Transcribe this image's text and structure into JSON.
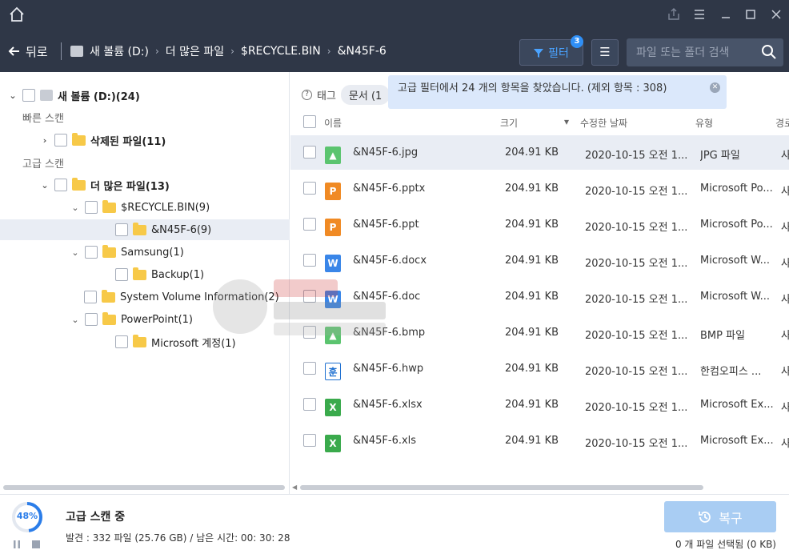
{
  "titlebar": {
    "home_icon": "home-icon",
    "controls": [
      "share-icon",
      "menu-icon",
      "minimize-icon",
      "maximize-icon",
      "close-icon"
    ]
  },
  "nav": {
    "back_label": "뒤로",
    "breadcrumbs": [
      "새 볼륨 (D:)",
      "더 많은 파일",
      "$RECYCLE.BIN",
      "&N45F-6"
    ],
    "filter_label": "필터",
    "filter_badge": "3",
    "search_placeholder": "파일 또는 폴더 검색"
  },
  "tree": {
    "root": "새 볼륨 (D:)(24)",
    "quick_scan_title": "빠른 스캔",
    "deleted_files": "삭제된 파일(11)",
    "advanced_scan_title": "고급 스캔",
    "more_files": "더 많은 파일(13)",
    "recycle_bin": "$RECYCLE.BIN(9)",
    "n45f": "&N45F-6(9)",
    "samsung": "Samsung(1)",
    "backup": "Backup(1)",
    "system_volume": "System Volume Information(2)",
    "powerpoint": "PowerPoint(1)",
    "ms_account": "Microsoft 계정(1)"
  },
  "tagbar": {
    "label": "태그",
    "chip": "문서 (1"
  },
  "tooltip": {
    "text": "고급 필터에서 24 개의 항목을 찾았습니다. (제외 항목 :  308)"
  },
  "table": {
    "headers": {
      "name": "이름",
      "size": "크기",
      "date": "수정한 날짜",
      "type": "유형",
      "path": "경로"
    },
    "rows": [
      {
        "name": "&N45F-6.jpg",
        "size": "204.91 KB",
        "date": "2020-10-15 오전 1...",
        "type": "JPG 파일",
        "path": "사",
        "icon": "image-file-icon",
        "color": "#5bc46f",
        "glyph": "▲"
      },
      {
        "name": "&N45F-6.pptx",
        "size": "204.91 KB",
        "date": "2020-10-15 오전 1...",
        "type": "Microsoft Po...",
        "path": "사",
        "icon": "powerpoint-file-icon",
        "color": "#f08a24",
        "glyph": "P"
      },
      {
        "name": "&N45F-6.ppt",
        "size": "204.91 KB",
        "date": "2020-10-15 오전 1...",
        "type": "Microsoft Po...",
        "path": "사",
        "icon": "powerpoint-file-icon",
        "color": "#f08a24",
        "glyph": "P"
      },
      {
        "name": "&N45F-6.docx",
        "size": "204.91 KB",
        "date": "2020-10-15 오전 1...",
        "type": "Microsoft W...",
        "path": "사",
        "icon": "word-file-icon",
        "color": "#3a86e8",
        "glyph": "W"
      },
      {
        "name": "&N45F-6.doc",
        "size": "204.91 KB",
        "date": "2020-10-15 오전 1...",
        "type": "Microsoft W...",
        "path": "사",
        "icon": "word-file-icon",
        "color": "#3a86e8",
        "glyph": "W"
      },
      {
        "name": "&N45F-6.bmp",
        "size": "204.91 KB",
        "date": "2020-10-15 오전 1...",
        "type": "BMP 파일",
        "path": "사",
        "icon": "image-file-icon",
        "color": "#5bc46f",
        "glyph": "▲"
      },
      {
        "name": "&N45F-6.hwp",
        "size": "204.91 KB",
        "date": "2020-10-15 오전 1...",
        "type": "한컴오피스 ...",
        "path": "사",
        "icon": "hwp-file-icon",
        "color": "#ffffff",
        "glyph": "훈"
      },
      {
        "name": "&N45F-6.xlsx",
        "size": "204.91 KB",
        "date": "2020-10-15 오전 1...",
        "type": "Microsoft Ex...",
        "path": "사",
        "icon": "excel-file-icon",
        "color": "#3aaa4c",
        "glyph": "X"
      },
      {
        "name": "&N45F-6.xls",
        "size": "204.91 KB",
        "date": "2020-10-15 오전 1...",
        "type": "Microsoft Ex...",
        "path": "사",
        "icon": "excel-file-icon",
        "color": "#3aaa4c",
        "glyph": "X"
      }
    ]
  },
  "scan": {
    "progress_label": "48%",
    "progress_fraction": 0.48,
    "title": "고급 스캔 중",
    "info": "발견 : 332 파일 (25.76 GB) / 남은 시간: 00: 30: 28"
  },
  "recover": {
    "label": "복구",
    "selection_info": "0 개 파일 선택됨 (0 KB)"
  },
  "colors": {
    "titlebar_bg": "#2f3747",
    "accent": "#2f8ff6",
    "recover_disabled": "#a9cdf3",
    "selected_row": "#e9edf4"
  }
}
